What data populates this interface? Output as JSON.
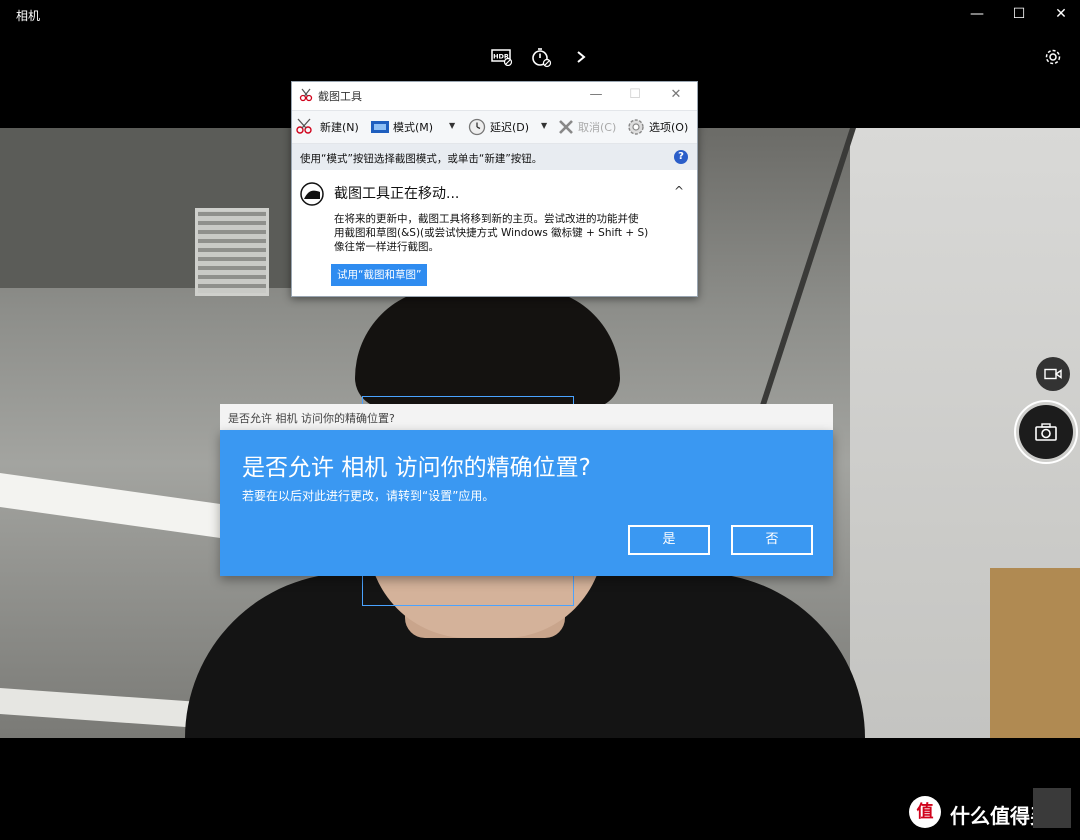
{
  "app": {
    "title": "相机",
    "window_buttons": {
      "minimize": "—",
      "maximize": "☐",
      "close": "✕"
    }
  },
  "top_toolbar": {
    "icons": [
      "hdr-icon",
      "timer-icon",
      "chevron-right-icon"
    ],
    "settings_icon": "gear-icon"
  },
  "snipping_tool": {
    "title": "截图工具",
    "window_buttons": {
      "minimize": "—",
      "maximize": "☐",
      "close": "✕"
    },
    "toolbar": {
      "new_label": "新建(N)",
      "mode_label": "模式(M)",
      "delay_label": "延迟(D)",
      "cancel_label": "取消(C)",
      "options_label": "选项(O)"
    },
    "hint": "使用“模式”按钮选择截图模式，或单击“新建”按钮。",
    "help_label": "?",
    "notice": {
      "title": "截图工具正在移动...",
      "body_line1": "在将来的更新中，截图工具将移到新的主页。尝试改进的功能并使",
      "body_line2": "用截图和草图(&S)(或尝试快捷方式 Windows 徽标键 + Shift + S)",
      "body_line3": "像往常一样进行截图。",
      "try_button": "试用“截图和草图”",
      "collapse_glyph": "^"
    }
  },
  "permission_dialog": {
    "bar_text": "是否允许 相机 访问你的精确位置?",
    "title": "是否允许 相机 访问你的精确位置?",
    "subtitle": "若要在以后对此进行更改，请转到“设置”应用。",
    "yes_label": "是",
    "no_label": "否",
    "accent_color": "#3a98f2"
  },
  "camera_controls": {
    "video_icon": "video-camera-icon",
    "shutter_icon": "camera-icon"
  },
  "watermark": {
    "logo_text": "值",
    "text": "什么值得买"
  }
}
